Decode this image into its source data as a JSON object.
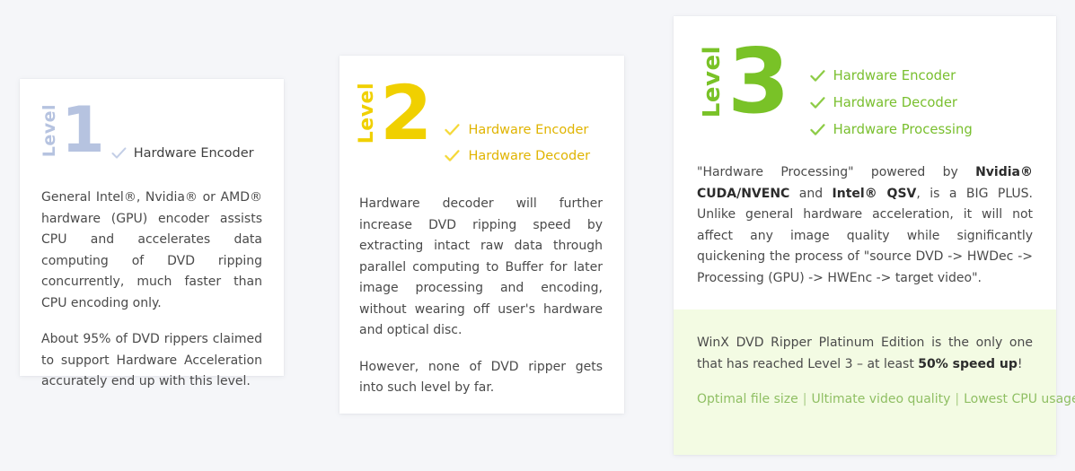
{
  "page": {
    "background_color": "#f5f6f9",
    "card_background": "#ffffff"
  },
  "cards": [
    {
      "id": "level-1",
      "accent_color": "#b6c3e0",
      "check_color": "#c3cee6",
      "feature_text_color": "#3f3f3f",
      "level_word": "Level",
      "level_number": "1",
      "features": [
        {
          "icon": "check-icon",
          "label": "Hardware Encoder"
        }
      ],
      "paragraphs": [
        "General Intel®, Nvidia® or AMD® hardware (GPU) encoder assists CPU and accelerates data computing of DVD ripping concurrently, much faster than CPU encoding only.",
        "About 95% of DVD rippers claimed to support Hardware Acceleration accurately end up with this level."
      ]
    },
    {
      "id": "level-2",
      "accent_color": "#f0d000",
      "check_color": "#f5d93a",
      "feature_text_color": "#e0b400",
      "level_word": "Level",
      "level_number": "2",
      "features": [
        {
          "icon": "check-icon",
          "label": "Hardware Encoder"
        },
        {
          "icon": "check-icon",
          "label": "Hardware Decoder"
        }
      ],
      "paragraphs": [
        "Hardware decoder will further increase DVD ripping speed by extracting intact raw data through parallel computing to Buffer for later image processing and encoding, without wearing off user's hardware and optical disc.",
        "However, none of DVD ripper gets into such level by far."
      ]
    },
    {
      "id": "level-3",
      "accent_color": "#79c227",
      "check_color": "#8dcc46",
      "feature_text_color": "#79bf2e",
      "level_word": "Level",
      "level_number": "3",
      "features": [
        {
          "icon": "check-icon",
          "label": "Hardware Encoder"
        },
        {
          "icon": "check-icon",
          "label": "Hardware Decoder"
        },
        {
          "icon": "check-icon",
          "label": "Hardware Processing"
        }
      ],
      "paragraph_rich": {
        "part1": "\"Hardware Processing\" powered by ",
        "bold1": "Nvidia® CUDA/NVENC",
        "part2": " and ",
        "bold2": "Intel® QSV",
        "part3": ", is a BIG PLUS. Unlike general hardware acceleration, it will not affect any image quality while significantly quickening the process of \"source DVD -> HWDec -> Processing (GPU) -> HWEnc -> target video\"."
      },
      "highlight": {
        "background_color": "#f3fbe3",
        "text_part1": "WinX DVD Ripper Platinum Edition is the only one that has reached Level 3 – at least ",
        "text_bold": "50% speed up",
        "text_part2": "!",
        "benefits": [
          "Optimal file size",
          "Ultimate video quality",
          "Lowest CPU usage"
        ],
        "separator": "|",
        "benefit_color": "#8fbf63"
      }
    }
  ]
}
